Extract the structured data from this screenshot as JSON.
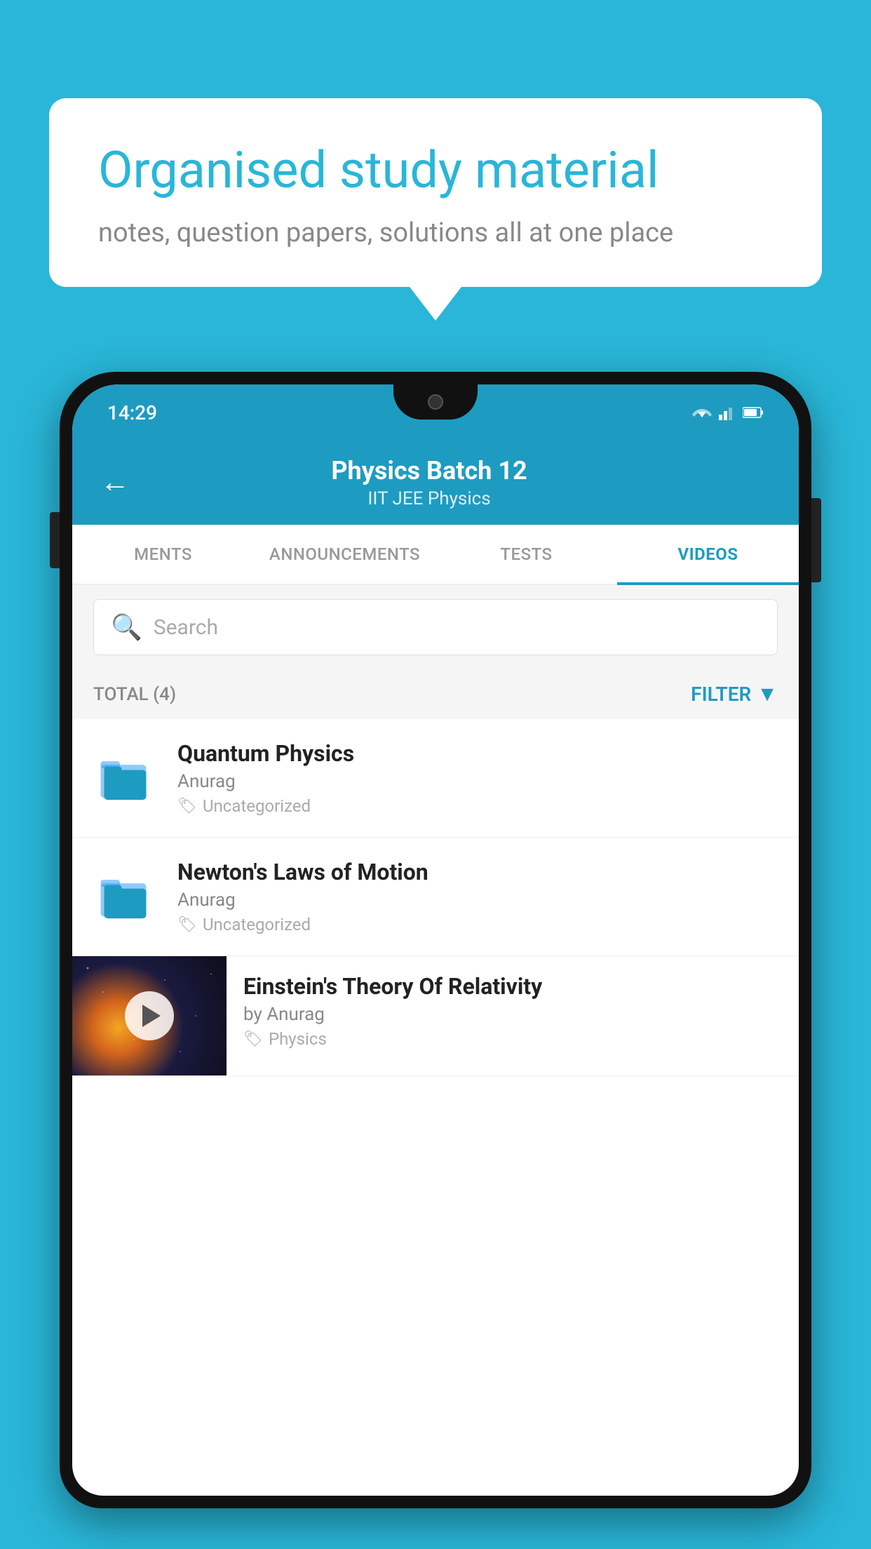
{
  "app": {
    "background_color": "#29b6d8"
  },
  "speech_bubble": {
    "title": "Organised study material",
    "subtitle": "notes, question papers, solutions all at one place"
  },
  "status_bar": {
    "time": "14:29"
  },
  "app_header": {
    "title": "Physics Batch 12",
    "subtitle": "IIT JEE   Physics",
    "back_label": "←"
  },
  "tabs": [
    {
      "label": "MENTS",
      "active": false
    },
    {
      "label": "ANNOUNCEMENTS",
      "active": false
    },
    {
      "label": "TESTS",
      "active": false
    },
    {
      "label": "VIDEOS",
      "active": true
    }
  ],
  "search": {
    "placeholder": "Search"
  },
  "filter_bar": {
    "total_label": "TOTAL (4)",
    "filter_label": "FILTER"
  },
  "list_items": [
    {
      "title": "Quantum Physics",
      "author": "Anurag",
      "tag": "Uncategorized",
      "type": "folder"
    },
    {
      "title": "Newton's Laws of Motion",
      "author": "Anurag",
      "tag": "Uncategorized",
      "type": "folder"
    },
    {
      "title": "Einstein's Theory Of Relativity",
      "author": "by Anurag",
      "tag": "Physics",
      "type": "video"
    }
  ]
}
